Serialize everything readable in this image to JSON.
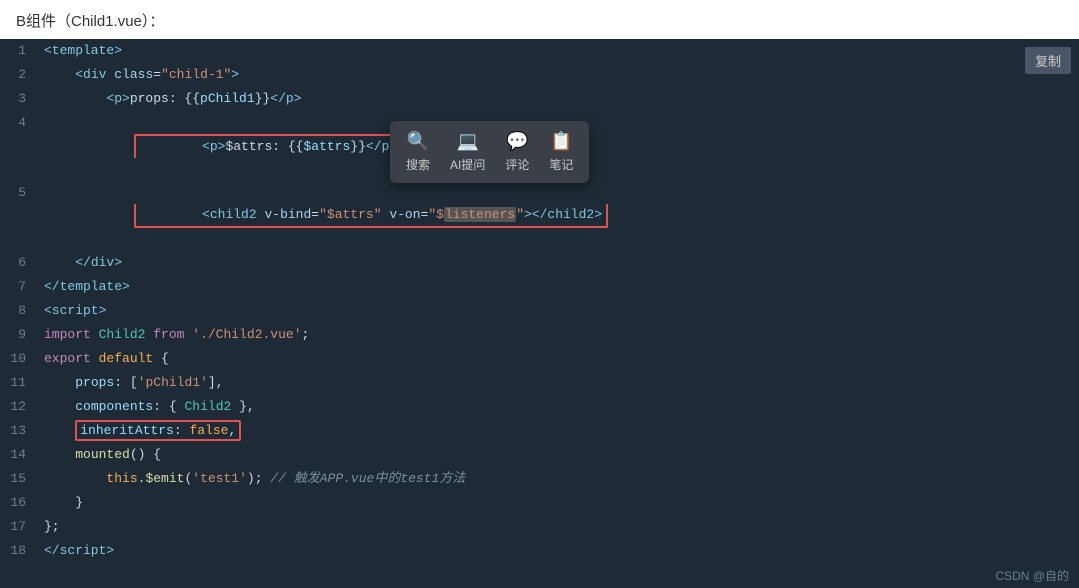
{
  "title": "B组件（Child1.vue）：",
  "copy_btn": "复制",
  "csdn": "CSDN @自的",
  "tooltip": {
    "items": [
      {
        "icon": "🔍",
        "label": "搜索"
      },
      {
        "icon": "🤖",
        "label": "AI提问"
      },
      {
        "icon": "💬",
        "label": "评论"
      },
      {
        "icon": "📋",
        "label": "笔记"
      }
    ]
  },
  "lines": [
    {
      "num": 1,
      "code": "<template>"
    },
    {
      "num": 2,
      "code": "    <div class=\"child-1\">"
    },
    {
      "num": 3,
      "code": "        <p>props: {{pChild1}}</p>"
    },
    {
      "num": 4,
      "code": "        <p>$attrs: {{$attrs}}</p>"
    },
    {
      "num": 5,
      "code": "        <child2 v-bind=\"$attrs\" v-on=\"$listeners\"></child2>"
    },
    {
      "num": 6,
      "code": "    </div>"
    },
    {
      "num": 7,
      "code": "</template>"
    },
    {
      "num": 8,
      "code": "<script>"
    },
    {
      "num": 9,
      "code": "import Child2 from './Child2.vue';"
    },
    {
      "num": 10,
      "code": "export default {"
    },
    {
      "num": 11,
      "code": "    props: ['pChild1'],"
    },
    {
      "num": 12,
      "code": "    components: { Child2 },"
    },
    {
      "num": 13,
      "code": "    inheritAttrs: false,"
    },
    {
      "num": 14,
      "code": "    mounted() {"
    },
    {
      "num": 15,
      "code": "        this.$emit('test1'); // 触发APP.vue中的test1方法"
    },
    {
      "num": 16,
      "code": "    }"
    },
    {
      "num": 17,
      "code": "};"
    },
    {
      "num": 18,
      "code": "</script>"
    }
  ]
}
